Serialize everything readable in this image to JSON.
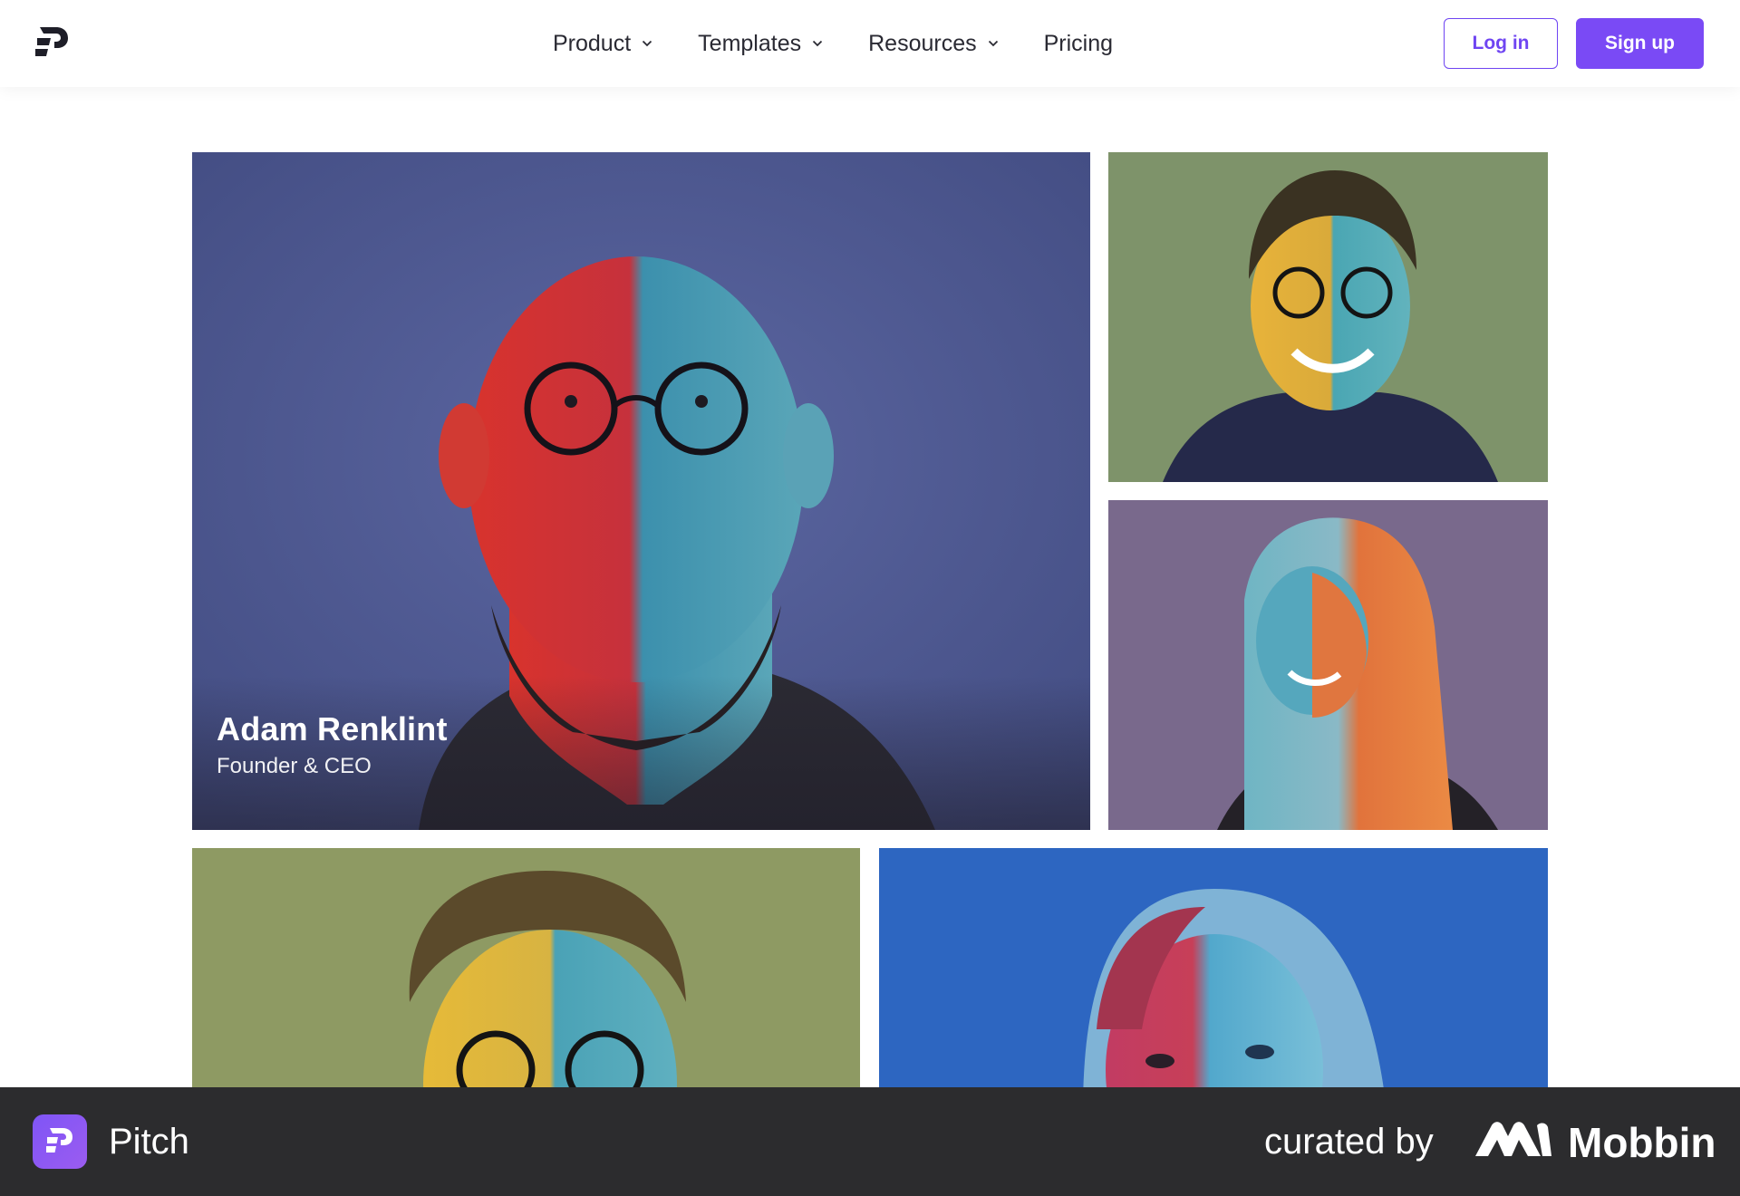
{
  "header": {
    "logo_icon": "pitch-logo-icon",
    "nav": [
      {
        "label": "Product",
        "has_dropdown": true
      },
      {
        "label": "Templates",
        "has_dropdown": true
      },
      {
        "label": "Resources",
        "has_dropdown": true
      },
      {
        "label": "Pricing",
        "has_dropdown": false
      }
    ],
    "login_label": "Log in",
    "signup_label": "Sign up"
  },
  "team": {
    "featured": {
      "name": "Adam Renklint",
      "role": "Founder & CEO",
      "social": [
        "twitter-icon",
        "linkedin-icon"
      ]
    }
  },
  "footer": {
    "app_name": "Pitch",
    "curated_by": "curated by",
    "brand": "Mobbin"
  },
  "colors": {
    "accent": "#7a4af5",
    "footer_bg": "#2c2c2e"
  }
}
